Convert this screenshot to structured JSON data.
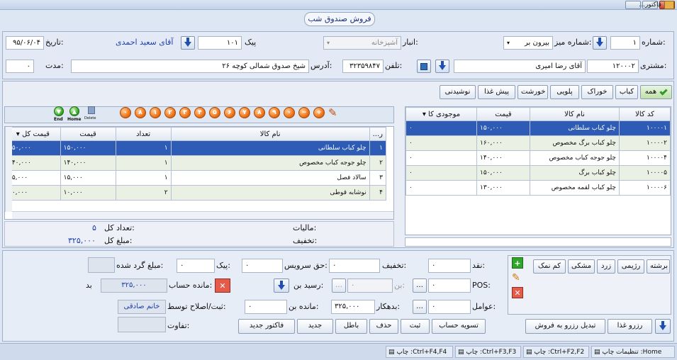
{
  "window": {
    "title": "...فاکتور"
  },
  "header": {
    "section_title": "فروش صندوق شب"
  },
  "row1": {
    "number_label": "شماره:",
    "number_value": "۱",
    "table_label": "شماره میز:",
    "table_value": "بیرون بر",
    "warehouse_label": "انبار:",
    "warehouse_value": "آشپزخانه",
    "courier_label": "پیک",
    "courier_value": "۱۰۱",
    "courier_name": "آقای سعید احمدی",
    "date_label": "تاریخ:",
    "date_value": "۹۵/۰۶/۰۴"
  },
  "row2": {
    "customer_label": "مشتری:",
    "customer_code": "۱۲۰۰۰۲",
    "customer_name": "آقای رضا امیری",
    "phone_label": "تلفن:",
    "phone_value": "۳۲۳۵۹۸۴۷",
    "address_label": "آدرس:",
    "address_value": "شیخ صدوق شمالی کوچه ۲۶",
    "duration_label": "مدت:",
    "duration_value": "۰"
  },
  "categories": [
    "همه",
    "کباب",
    "خوراک",
    "پلویی",
    "خورشت",
    "پیش غذا",
    "نوشیدنی"
  ],
  "products": {
    "columns": [
      "کد کالا",
      "نام کالا",
      "قیمت",
      "موجودی کا"
    ],
    "rows": [
      {
        "code": "۱۰۰۰۰۱",
        "name": "چلو کباب سلطانی",
        "price": "۱۵۰,۰۰۰",
        "stock": "۰"
      },
      {
        "code": "۱۰۰۰۰۲",
        "name": "چلو کباب برگ مخصوص",
        "price": "۱۶۰,۰۰۰",
        "stock": "۰"
      },
      {
        "code": "۱۰۰۰۰۴",
        "name": "چلو جوجه کباب مخصوص",
        "price": "۱۴۰,۰۰۰",
        "stock": "۰"
      },
      {
        "code": "۱۰۰۰۰۵",
        "name": "چلو کباب برگ",
        "price": "۱۵۰,۰۰۰",
        "stock": "۰"
      },
      {
        "code": "۱۰۰۰۰۶",
        "name": "چلو کباب لقمه مخصوص",
        "price": "۱۳۰,۰۰۰",
        "stock": "۰"
      }
    ]
  },
  "keypad": {
    "end": "End",
    "home": "Home",
    "del": "Delete",
    "digits": [
      "۰",
      "۸",
      "۱",
      "۲",
      "۳",
      "۴",
      "۵",
      "۶",
      "۷",
      "۸",
      "۹"
    ]
  },
  "invoice": {
    "columns": [
      "ر...",
      "نام کالا",
      "تعداد",
      "قیمت",
      "قیمت کل"
    ],
    "rows": [
      {
        "row": "۱",
        "name": "چلو کباب سلطانی",
        "qty": "۱",
        "price": "۱۵۰,۰۰۰",
        "total": "۱۵۰,۰۰۰"
      },
      {
        "row": "۲",
        "name": "چلو جوجه کباب مخصوص",
        "qty": "۱",
        "price": "۱۴۰,۰۰۰",
        "total": "۱۴۰,۰۰۰"
      },
      {
        "row": "۳",
        "name": "سالاد فصل",
        "qty": "۱",
        "price": "۱۵,۰۰۰",
        "total": "۱۵,۰۰۰"
      },
      {
        "row": "۴",
        "name": "نوشابه قوطی",
        "qty": "۲",
        "price": "۱۰,۰۰۰",
        "total": "۲۰,۰۰۰"
      }
    ],
    "tax_label": "مالیات:",
    "discount_label": "تخفیف:",
    "total_count_label": "تعداد کل:",
    "total_count_value": "۵",
    "total_amount_label": "مبلغ کل:",
    "total_amount_value": "۳۲۵,۰۰۰"
  },
  "options": [
    "برشته",
    "رژیمی",
    "زرد",
    "مشکی",
    "کم نمک"
  ],
  "bottom_left": {
    "btn_reserve": "رزرو غذا",
    "btn_convert": "تبدیل رزرو به فروش"
  },
  "payment": {
    "cash_label": "نقد:",
    "cash_value": "۰",
    "discount_label": "تخفیف:",
    "discount_value": "۰",
    "service_label": "حق سرویس:",
    "service_value": "۰",
    "courier_label": "پیک:",
    "courier_value": "۰",
    "rounding_label": "مبلغ گرد شده:",
    "pos_label": "POS:",
    "pos_value": "۰",
    "coupon_label": "بن:",
    "coupon_value": "۰",
    "coupon_receipt_label": "رسید بن:",
    "balance_label": "مانده حساب:",
    "balance_value": "۳۲۵,۰۰۰",
    "balance_state": "بد",
    "agents_label": "عوامل:",
    "agents_value": "۰",
    "debtor_label": "بدهکار:",
    "debtor_value": "۳۲۵,۰۰۰",
    "coupon_rem_label": "مانده بن:",
    "coupon_rem_value": "۰",
    "edited_by_label": "ثبت/اصلاح توسط:",
    "edited_by_value": "خانم صادقی",
    "diff_label": "تفاوت:"
  },
  "actions": [
    "تسویه حساب",
    "ثبت",
    "حذف",
    "باطل",
    "جدید",
    "فاکتور جدید"
  ],
  "status": [
    "تنظیمات چاپ :Home",
    "چاپ :Ctrl+F2,F2",
    "چاپ :Ctrl+F3,F3",
    "چاپ :Ctrl+F4,F4"
  ]
}
